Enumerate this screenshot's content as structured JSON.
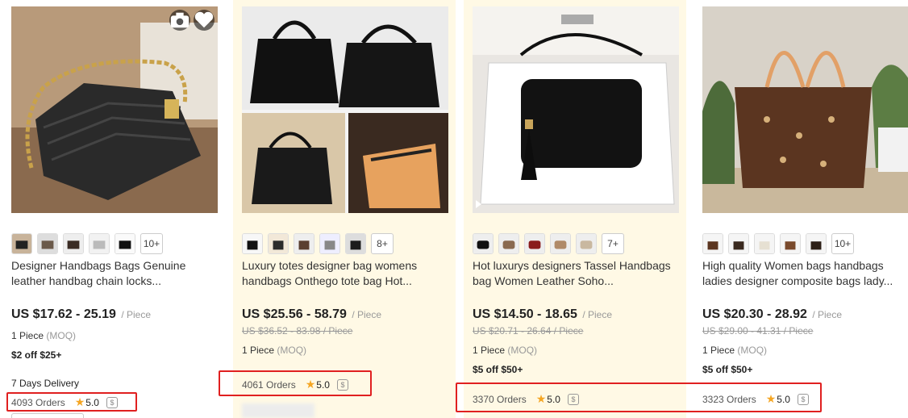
{
  "products": [
    {
      "title": "Designer Handbags Bags Genuine leather handbag chain locks...",
      "price": "US $17.62 - 25.19",
      "unit": "/ Piece",
      "moq": "1 Piece",
      "moq_tag": "(MOQ)",
      "promo": "$2 off $25+",
      "delivery": "7 Days Delivery",
      "orders": "4093 Orders",
      "rating": "5.0",
      "more_variants": "10+"
    },
    {
      "title": "Luxury totes designer bag womens handbags Onthego tote bag Hot...",
      "price": "US $25.56 - 58.79",
      "unit": "/ Piece",
      "old_price": "US $36.52 - 83.98 / Piece",
      "moq": "1 Piece",
      "moq_tag": "(MOQ)",
      "orders": "4061 Orders",
      "rating": "5.0",
      "more_variants": "8+"
    },
    {
      "title": "Hot luxurys designers Tassel Handbags bag Women Leather Soho...",
      "price": "US $14.50 - 18.65",
      "unit": "/ Piece",
      "old_price": "US $20.71 - 26.64 / Piece",
      "moq": "1 Piece",
      "moq_tag": "(MOQ)",
      "promo": "$5 off $50+",
      "orders": "3370 Orders",
      "rating": "5.0",
      "more_variants": "7+"
    },
    {
      "title": "High quality Women bags handbags ladies designer composite bags lady...",
      "price": "US $20.30 - 28.92",
      "unit": "/ Piece",
      "old_price": "US $29.00 - 41.31 / Piece",
      "moq": "1 Piece",
      "moq_tag": "(MOQ)",
      "promo": "$5 off $50+",
      "orders": "3323 Orders",
      "rating": "5.0",
      "more_variants": "10+"
    }
  ],
  "icons": {
    "camera": "camera-icon",
    "heart": "heart-icon",
    "star": "star-icon",
    "shield": "trade-assurance-icon",
    "play": "play-icon"
  },
  "colors": {
    "highlight_border": "#e02020",
    "card_highlight_bg": "#fff9e5",
    "star": "#f5a623"
  }
}
